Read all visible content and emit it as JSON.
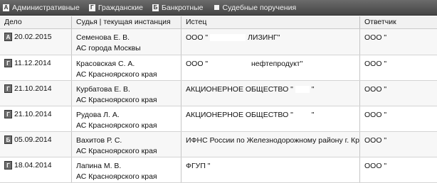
{
  "filters": [
    {
      "badge": "A",
      "label": "Административные"
    },
    {
      "badge": "Г",
      "label": "Гражданские"
    },
    {
      "badge": "Б",
      "label": "Банкротные"
    },
    {
      "badge": "",
      "label": "Судебные поручения"
    }
  ],
  "headers": [
    "Дело",
    "Судья | текущая инстанция",
    "Истец",
    "Ответчик"
  ],
  "rows": [
    {
      "type": "A",
      "date": "20.02.2015",
      "judge": "Семенова Е. В.",
      "court": "АС города Москвы",
      "plaintiff_a": "ООО \"",
      "plaintiff_b": "ЛИЗИНГ\"",
      "defendant": "ООО \""
    },
    {
      "type": "Г",
      "date": "11.12.2014",
      "judge": "Красовская С. А.",
      "court": "АС Красноярского края",
      "plaintiff_a": "ООО \"",
      "plaintiff_b": "нефтепродукт\"",
      "defendant": "ООО \""
    },
    {
      "type": "Г",
      "date": "21.10.2014",
      "judge": "Курбатова Е. В.",
      "court": "АС Красноярского края",
      "plaintiff_a": "АКЦИОНЕРНОЕ ОБЩЕСТВО \"",
      "plaintiff_b": "\"",
      "defendant": "ООО \""
    },
    {
      "type": "Г",
      "date": "21.10.2014",
      "judge": "Рудова Л. А.",
      "court": "АС Красноярского края",
      "plaintiff_a": "АКЦИОНЕРНОЕ ОБЩЕСТВО \"",
      "plaintiff_b": "\"",
      "defendant": "ООО \""
    },
    {
      "type": "Б",
      "date": "05.09.2014",
      "judge": "Вахитов Р. С.",
      "court": "АС Красноярского края",
      "plaintiff_a": "ИФНС России по Железнодорожному району г. Красноярс",
      "plaintiff_b": "",
      "defendant": "ООО \""
    },
    {
      "type": "Г",
      "date": "18.04.2014",
      "judge": "Лапина М. В.",
      "court": "АС Красноярского края",
      "plaintiff_a": "ФГУП \"",
      "plaintiff_b": "",
      "defendant": "ООО \""
    }
  ]
}
